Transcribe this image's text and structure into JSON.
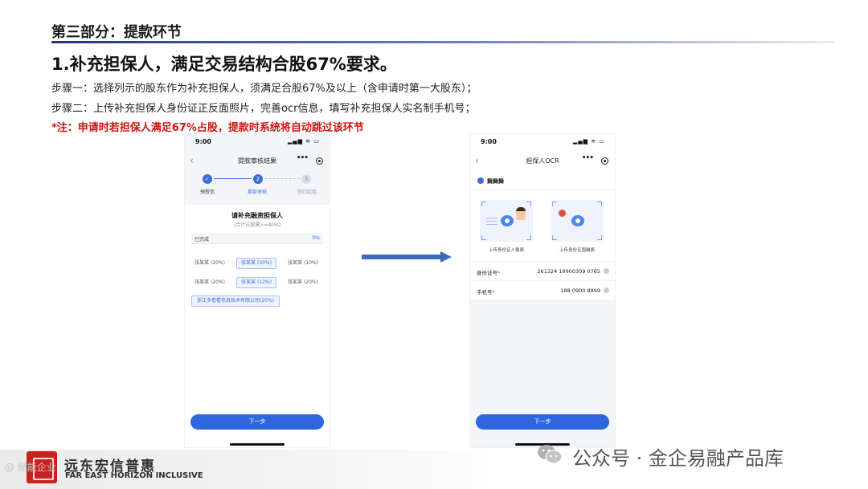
{
  "slide": {
    "section_title": "第三部分：提款环节",
    "heading": "1.补充担保人，满足交易结构合股67%要求。",
    "step1": "步骤一：选择列示的股东作为补充担保人，须满足合股67%及以上（含申请时第一大股东）；",
    "step2": "步骤二：上传补充担保人身份证正反面照片，完善ocr信息，填写补充担保人实名制手机号；",
    "note": "*注：申请时若担保人满足67%占股，提款时系统将自动跳过该环节",
    "colors": {
      "accent": "#2f66e0",
      "note_red": "#d01414",
      "arrow": "#3d6bb7"
    }
  },
  "left_phone": {
    "time": "9:00",
    "status_icons": "▂▄▆ ≋ ▭",
    "nav_title": "提款审核结果",
    "nav_back": "‹",
    "nav_more": "•••",
    "steps": [
      {
        "num": "✓",
        "label": "预授信"
      },
      {
        "num": "2",
        "label": "提款审核"
      },
      {
        "num": "3",
        "label": "签约起租"
      }
    ],
    "card_title": "请补充融资担保人",
    "card_subtitle": "(合计占股需>=40%)",
    "done_label": "已完成",
    "done_value": "0%",
    "chips": [
      "张某某 (20%)",
      "张某某 (30%)",
      "张某某 (10%)",
      "张某某 (20%)",
      "张某某 (12%)",
      "张某某 (20%)",
      "浙江多看看信息技术有限公司(20%)"
    ],
    "button": "下一步"
  },
  "right_phone": {
    "time": "9:00",
    "status_icons": "▂▄▆ ≋ ▭",
    "nav_title": "担保人OCR",
    "nav_back": "‹",
    "nav_more": "•••",
    "user_name": "舞舞舞",
    "id_front_label": "上传身份证人像面",
    "id_back_label": "上传身份证国徽面",
    "fields": [
      {
        "label": "身份证号",
        "required": "*",
        "value": "261324 19900309 0765"
      },
      {
        "label": "手机号",
        "required": "*",
        "value": "188 0900 8899"
      }
    ],
    "button": "下一步"
  },
  "footer": {
    "logo_cn": "远东宏信普惠",
    "logo_en": "FAR EAST HORIZON INCLUSIVE",
    "left_watermark": "@ 赋能企业",
    "watermark": "公众号 · 金企易融产品库"
  }
}
